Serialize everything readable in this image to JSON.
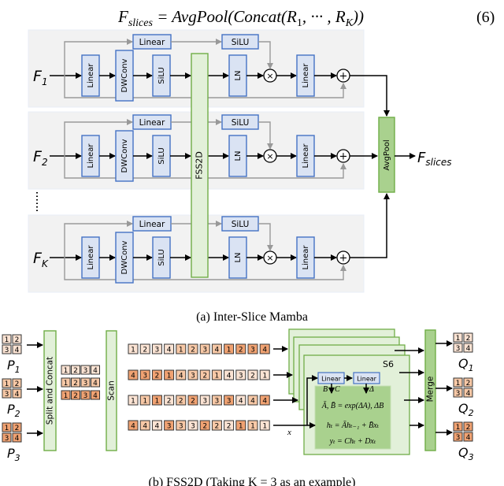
{
  "equation": {
    "lhs": "F",
    "lhs_sub": "slices",
    "rhs": "= AvgPool(Concat(R",
    "rhs_sub1": "1",
    "rhs_mid": ", ··· , R",
    "rhs_sub2": "K",
    "rhs_end": "))",
    "number": "(6)"
  },
  "inter_slice": {
    "caption": "(a) Inter-Slice Mamba",
    "rows": [
      {
        "input": "F",
        "sub": "1"
      },
      {
        "input": "F",
        "sub": "2"
      },
      {
        "input": "F",
        "sub": "K"
      }
    ],
    "ellipsis": "⋮",
    "blocks": {
      "linear_top": "Linear",
      "silu_top": "SiLU",
      "linear_in": "Linear",
      "dwconv": "DWConv",
      "silu": "SiLU",
      "ln": "LN",
      "linear_out": "Linear",
      "mul": "×",
      "add": "+"
    },
    "fss2d": "FSS2D",
    "avgpool": "AvgPool",
    "output": "F",
    "output_sub": "slices"
  },
  "fss2d": {
    "caption": "(b) FSS2D (Taking K = 3 as an example)",
    "inputs": [
      {
        "label": "P",
        "sub": "1",
        "shade": 0
      },
      {
        "label": "P",
        "sub": "2",
        "shade": 1
      },
      {
        "label": "P",
        "sub": "3",
        "shade": 2
      }
    ],
    "outputs": [
      {
        "label": "Q",
        "sub": "1",
        "shade": 0
      },
      {
        "label": "Q",
        "sub": "2",
        "shade": 1
      },
      {
        "label": "Q",
        "sub": "3",
        "shade": 2
      }
    ],
    "patch_tokens": [
      "1",
      "2",
      "3",
      "4"
    ],
    "split_concat": "Split and Concat",
    "scan": "Scan",
    "merge": "Merge",
    "sequences": [
      {
        "tokens": [
          "1",
          "2",
          "3",
          "4",
          "1",
          "2",
          "3",
          "4",
          "1",
          "2",
          "3",
          "4"
        ],
        "shades": [
          0,
          0,
          0,
          0,
          1,
          1,
          1,
          1,
          2,
          2,
          2,
          2
        ]
      },
      {
        "tokens": [
          "4",
          "3",
          "2",
          "1",
          "4",
          "3",
          "2",
          "1",
          "4",
          "3",
          "2",
          "1"
        ],
        "shades": [
          2,
          2,
          2,
          2,
          1,
          1,
          1,
          1,
          0,
          0,
          0,
          0
        ]
      },
      {
        "tokens": [
          "1",
          "1",
          "1",
          "2",
          "2",
          "2",
          "3",
          "3",
          "3",
          "4",
          "4",
          "4"
        ],
        "shades": [
          0,
          1,
          2,
          0,
          1,
          2,
          0,
          1,
          2,
          0,
          1,
          2
        ]
      },
      {
        "tokens": [
          "4",
          "4",
          "4",
          "3",
          "3",
          "3",
          "2",
          "2",
          "2",
          "1",
          "1",
          "1"
        ],
        "shades": [
          2,
          1,
          0,
          2,
          1,
          0,
          2,
          1,
          0,
          2,
          1,
          0
        ]
      }
    ],
    "s6": {
      "label": "S6",
      "linear1": "Linear",
      "linear2": "Linear",
      "bc": "B",
      "bc2": "C",
      "delta": "Δ",
      "x": "x",
      "eq1": "Ā, B̄ = exp(ΔA), ΔB",
      "eq2": "hₜ = Āhₜ₋₁ + B̄xₜ",
      "eq3": "yₜ  =  Chₜ + Dxₜ"
    },
    "colors": {
      "shade0": "#fbe3d3",
      "shade1": "#f7c8a6",
      "shade2": "#f0a272",
      "green_fill": "#e2f0d9",
      "green_stroke": "#70ad47",
      "green_dark": "#a9d18e",
      "blue_fill": "#dae3f3",
      "blue_stroke": "#4472c4",
      "panel": "#f2f2f2"
    }
  }
}
